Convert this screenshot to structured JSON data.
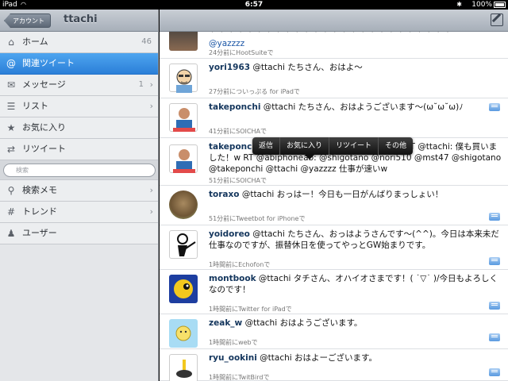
{
  "status_bar": {
    "carrier": "iPad",
    "time": "6:57",
    "battery": "100%"
  },
  "sidebar": {
    "back_label": "アカウント",
    "title": "ttachi",
    "items": [
      {
        "label": "ホーム",
        "icon": "home-icon",
        "count": "46"
      },
      {
        "label": "関連ツイート",
        "icon": "at-icon",
        "selected": true
      },
      {
        "label": "メッセージ",
        "icon": "envelope-icon",
        "count": "1"
      },
      {
        "label": "リスト",
        "icon": "list-icon"
      },
      {
        "label": "お気に入り",
        "icon": "star-icon"
      },
      {
        "label": "リツイート",
        "icon": "retweet-icon"
      }
    ],
    "search_placeholder": "検索",
    "bottom_items": [
      {
        "label": "検索メモ",
        "icon": "saved-search-icon"
      },
      {
        "label": "トレンド",
        "icon": "hash-icon"
      },
      {
        "label": "ユーザー",
        "icon": "user-icon"
      }
    ]
  },
  "popover": {
    "items": [
      "返信",
      "お気に入り",
      "リツイート",
      "その他"
    ]
  },
  "tweets": [
    {
      "text_line1": "・ ・ ・ ・ ・ ・ ・ ・ ・ ・ ・ ・ ・ ・ ・ ・ ・ ・ ・ ・ ・ ・ ・ ・ ・ ・",
      "mention": "@yazzzz",
      "meta": "24分前にHootSuiteで"
    },
    {
      "user": "yori1963",
      "text": " @ttachi たちさん、おはよ〜",
      "meta": "27分前についっぷる for iPadで"
    },
    {
      "user": "takeponchi",
      "text": " @ttachi たちさん、おはようございます〜(ω˘ω˘ω)ﾉ",
      "meta": "41分前にSOICHAで"
    },
    {
      "user": "takeponchi",
      "text": " ノ RT @abiphoneab: ( ^^)人(^^ )RT @ttachi: 僕も買いました！w RT @abiphoneab: @shigotano @nori510 @mst47 @shigotano @takeponchi @ttachi @yazzzz 仕事が速いw",
      "meta": "51分前にSOICHAで"
    },
    {
      "user": "toraxo",
      "text": " @ttachi おっはー！今日も一日がんばりまっしょい！",
      "meta": "51分前にTweetbot for iPhoneで"
    },
    {
      "user": "yoidoreo",
      "text": " @ttachi たちさん、おっはようさんです〜(^^)。今日は本来未だ仕事なのですが、振替休日を使ってやっとGW始まりです。",
      "meta": "1時間前にEchofonで"
    },
    {
      "user": "montbook",
      "text": " @ttachi タチさん、オハイオさまです！( ˙▽˙ )/今日もよろしくなのです！",
      "meta": "1時間前にTwitter for iPadで"
    },
    {
      "user": "zeak_w",
      "text": " @ttachi おはようございます。",
      "meta": "1時間前にwebで"
    },
    {
      "user": "ryu_ookini",
      "text": " @ttachi おはよーございます。",
      "meta": "1時間前にTwitBirdで"
    }
  ]
}
